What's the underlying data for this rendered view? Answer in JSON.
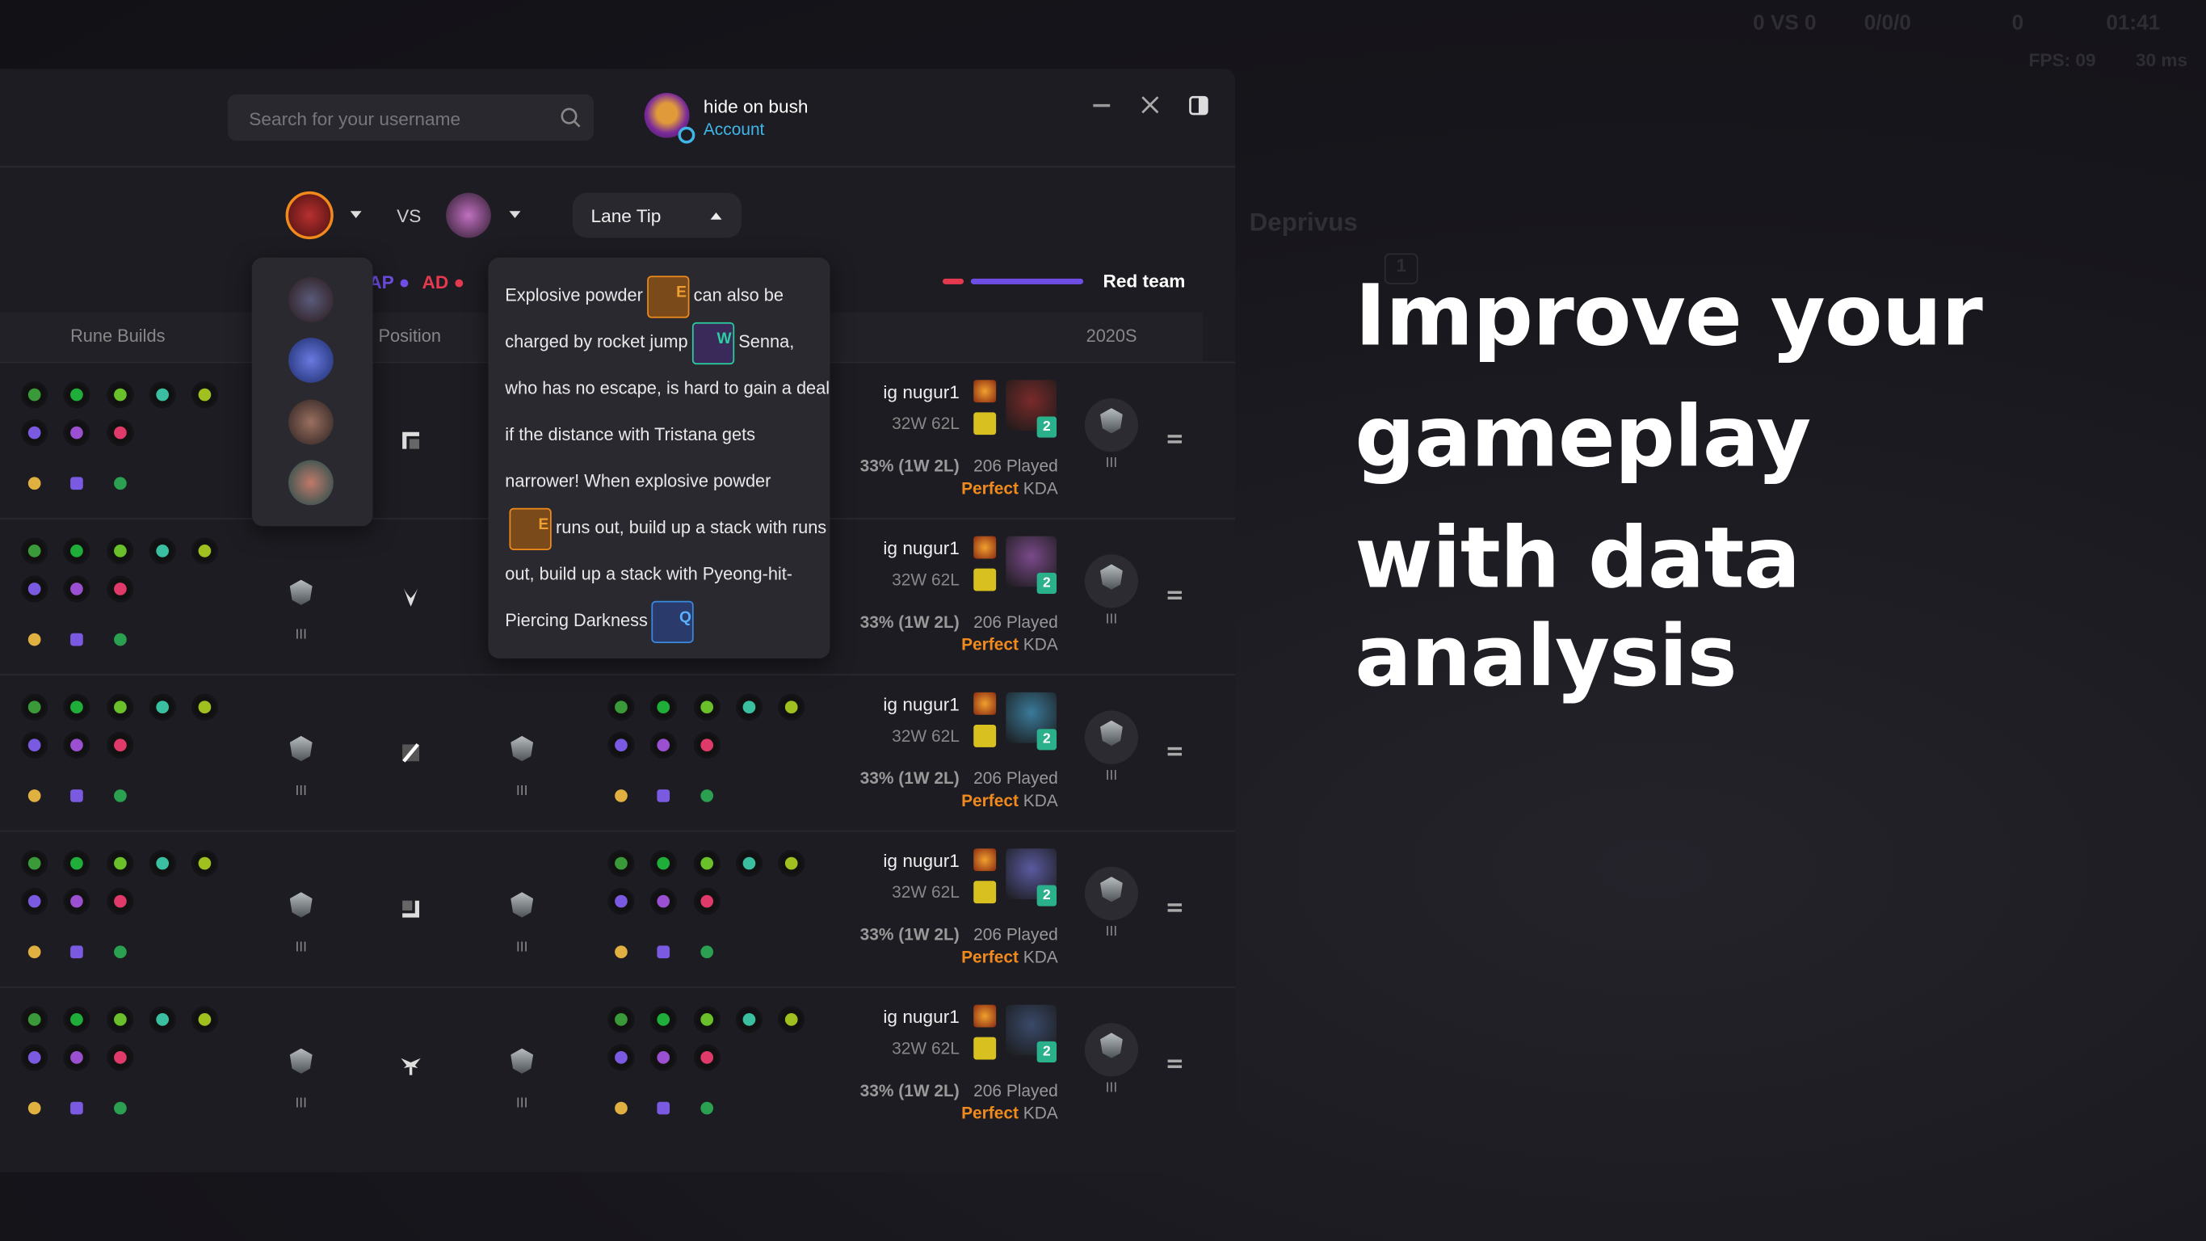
{
  "hud": {
    "score": "0 VS 0",
    "kda": "0/0/0",
    "gold": "0",
    "time": "01:41",
    "fps": "FPS: 09",
    "ping": "30 ms",
    "enemy_name": "Deprivus",
    "level": "1"
  },
  "header": {
    "search_placeholder": "Search for your username",
    "username": "hide on bush",
    "account_link": "Account"
  },
  "matchup": {
    "vs": "VS",
    "dropdown_label": "Lane Tip",
    "ap_label": "AP",
    "ad_label": "AD",
    "team_label": "Red team",
    "colors": {
      "ap": "#6f4ee6",
      "ad": "#e5394f",
      "accent": "#f08a1c"
    }
  },
  "columns": {
    "runes": "Rune Builds",
    "position": "Position",
    "season": "2020S"
  },
  "tooltip": {
    "parts": [
      "Explosive powder",
      "can also be charged by rocket jump",
      "Senna, who has no escape, is hard to gain a deal if the distance with Tristana gets narrower! When explosive powder",
      "runs out, build up a stack with runs out, build up a stack with Pyeong-hit-Piercing Darkness"
    ],
    "keys": [
      "E",
      "W",
      "E",
      "Q"
    ]
  },
  "rows": [
    {
      "position": "top",
      "name": "ig nugur1",
      "record": "32W 62L",
      "winrate": "33% (1W 2L)",
      "played": "206 Played",
      "kda_value": "Perfect",
      "kda_label": "KDA",
      "level": "2",
      "tier": "III",
      "champ_color": "#7a2a2a"
    },
    {
      "position": "jungle",
      "name": "ig nugur1",
      "record": "32W 62L",
      "winrate": "33% (1W 2L)",
      "played": "206 Played",
      "kda_value": "Perfect",
      "kda_label": "KDA",
      "level": "2",
      "tier": "III",
      "champ_color": "#7a4a8a"
    },
    {
      "position": "mid",
      "name": "ig nugur1",
      "record": "32W 62L",
      "winrate": "33% (1W 2L)",
      "played": "206 Played",
      "kda_value": "Perfect",
      "kda_label": "KDA",
      "level": "2",
      "tier": "III",
      "champ_color": "#3a7a9a"
    },
    {
      "position": "bottom",
      "name": "ig nugur1",
      "record": "32W 62L",
      "winrate": "33% (1W 2L)",
      "played": "206 Played",
      "kda_value": "Perfect",
      "kda_label": "KDA",
      "level": "2",
      "tier": "III",
      "champ_color": "#5a5aa0"
    },
    {
      "position": "support",
      "name": "ig nugur1",
      "record": "32W 62L",
      "winrate": "33% (1W 2L)",
      "played": "206 Played",
      "kda_value": "Perfect",
      "kda_label": "KDA",
      "level": "2",
      "tier": "III",
      "champ_color": "#3a4a6a"
    }
  ],
  "headline": [
    "Improve your",
    "gameplay",
    "with data analysis"
  ]
}
